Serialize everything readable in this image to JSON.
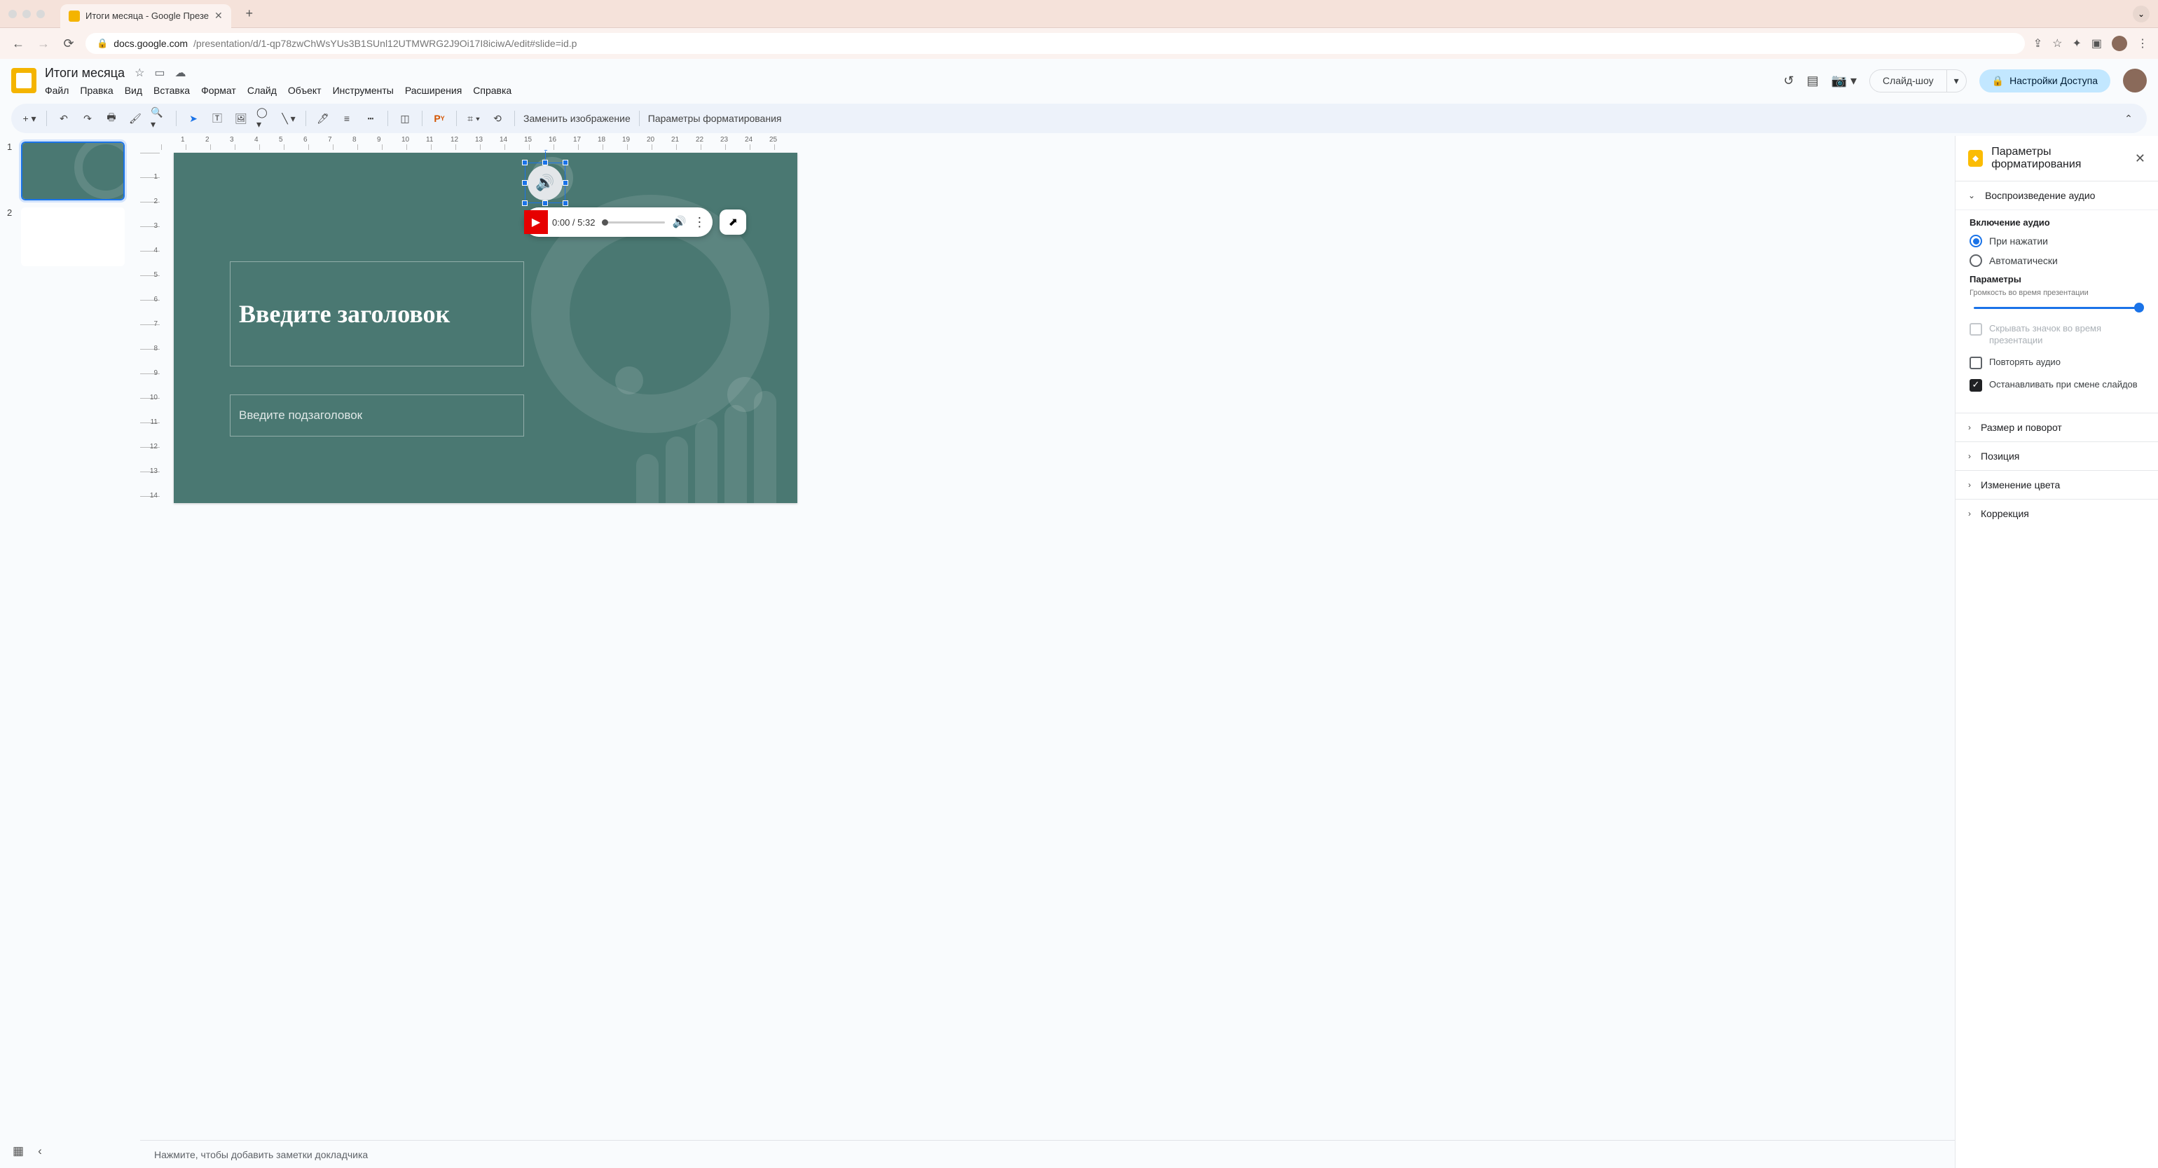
{
  "browser": {
    "tab_title": "Итоги месяца - Google Презе",
    "url_domain": "docs.google.com",
    "url_path": "/presentation/d/1-qp78zwChWsYUs3B1SUnl12UTMWRG2J9Oi17I8iciwA/edit#slide=id.p"
  },
  "header": {
    "doc_title": "Итоги месяца",
    "slideshow_label": "Слайд-шоу",
    "share_label": "Настройки Доступа"
  },
  "menus": [
    "Файл",
    "Правка",
    "Вид",
    "Вставка",
    "Формат",
    "Слайд",
    "Объект",
    "Инструменты",
    "Расширения",
    "Справка"
  ],
  "toolbar": {
    "replace_image": "Заменить изображение",
    "format_options": "Параметры форматирования"
  },
  "ruler_h": [
    "",
    "1",
    "2",
    "3",
    "4",
    "5",
    "6",
    "7",
    "8",
    "9",
    "10",
    "11",
    "12",
    "13",
    "14",
    "15",
    "16",
    "17",
    "18",
    "19",
    "20",
    "21",
    "22",
    "23",
    "24",
    "25"
  ],
  "ruler_v": [
    "",
    "1",
    "2",
    "3",
    "4",
    "5",
    "6",
    "7",
    "8",
    "9",
    "10",
    "11",
    "12",
    "13",
    "14"
  ],
  "thumbs": [
    {
      "num": "1",
      "selected": true
    },
    {
      "num": "2",
      "selected": false
    }
  ],
  "slide": {
    "title_placeholder": "Введите заголовок",
    "subtitle_placeholder": "Введите подзаголовок",
    "bar_heights": [
      70,
      95,
      120,
      140,
      160
    ]
  },
  "player": {
    "time": "0:00 / 5:32"
  },
  "notes": {
    "placeholder": "Нажмите, чтобы добавить заметки докладчика"
  },
  "sidepanel": {
    "title": "Параметры форматирования",
    "section_audio": "Воспроизведение аудио",
    "enable_label": "Включение аудио",
    "radio1": "При нажатии",
    "radio2": "Автоматически",
    "params_label": "Параметры",
    "volume_label": "Громкость во время презентации",
    "hide_icon": "Скрывать значок во время презентации",
    "loop_audio": "Повторять аудио",
    "stop_on_change": "Останавливать при смене слайдов",
    "coll1": "Размер и поворот",
    "coll2": "Позиция",
    "coll3": "Изменение цвета",
    "coll4": "Коррекция"
  }
}
